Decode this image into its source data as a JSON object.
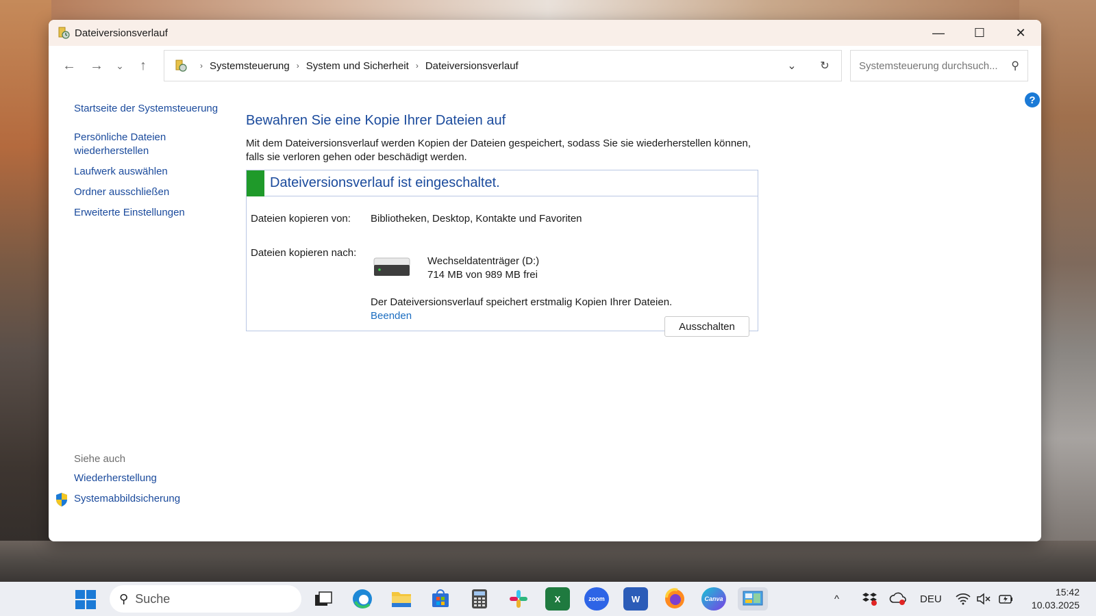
{
  "window": {
    "title": "Dateiversionsverlauf",
    "controls": {
      "minimize": "—",
      "maximize": "☐",
      "close": "✕"
    }
  },
  "nav": {
    "back": "←",
    "forward": "→",
    "recent": "⌄",
    "up": "↑",
    "breadcrumbs": [
      "Systemsteuerung",
      "System und Sicherheit",
      "Dateiversionsverlauf"
    ],
    "separator": "›",
    "dropdown": "⌄",
    "refresh": "↻"
  },
  "search": {
    "placeholder": "Systemsteuerung durchsuch...",
    "icon": "search-icon"
  },
  "sidebar": {
    "items": [
      {
        "label": "Startseite der Systemsteuerung"
      },
      {
        "label": "Persönliche Dateien wiederherstellen"
      },
      {
        "label": "Laufwerk auswählen"
      },
      {
        "label": "Ordner ausschließen"
      },
      {
        "label": "Erweiterte Einstellungen"
      }
    ],
    "see_also": {
      "title": "Siehe auch",
      "items": [
        {
          "label": "Wiederherstellung"
        },
        {
          "label": "Systemabbildsicherung"
        }
      ]
    }
  },
  "help": {
    "label": "?"
  },
  "main": {
    "title": "Bewahren Sie eine Kopie Ihrer Dateien auf",
    "description": "Mit dem Dateiversionsverlauf werden Kopien der Dateien gespeichert, sodass Sie sie wiederherstellen können, falls sie verloren gehen oder beschädigt werden.",
    "status": {
      "title": "Dateiversionsverlauf ist eingeschaltet.",
      "color": "#1f9a2a",
      "copy_from_label": "Dateien kopieren von:",
      "copy_from_value": "Bibliotheken, Desktop, Kontakte und Favoriten",
      "copy_to_label": "Dateien kopieren nach:",
      "drive_name": "Wechseldatenträger (D:)",
      "drive_free": "714 MB von 989 MB frei",
      "note": "Der Dateiversionsverlauf speichert erstmalig Kopien Ihrer Dateien.",
      "stop_link": "Beenden"
    },
    "off_button": "Ausschalten"
  },
  "taskbar": {
    "search_label": "Suche",
    "apps": [
      {
        "name": "task-view",
        "label": ""
      },
      {
        "name": "edge",
        "label": "e"
      },
      {
        "name": "file-explorer",
        "label": ""
      },
      {
        "name": "store",
        "label": ""
      },
      {
        "name": "calculator",
        "label": ""
      },
      {
        "name": "slack",
        "label": "✱"
      },
      {
        "name": "excel",
        "label": "X"
      },
      {
        "name": "zoom",
        "label": "zoom"
      },
      {
        "name": "word",
        "label": "W"
      },
      {
        "name": "firefox",
        "label": ""
      },
      {
        "name": "canva",
        "label": "Canva"
      },
      {
        "name": "control-panel",
        "label": ""
      }
    ],
    "tray": {
      "chevron": "^",
      "language": "DEU"
    },
    "time": "15:42",
    "date": "10.03.2025"
  },
  "colors": {
    "link": "#1a4a9c",
    "accent": "#1b7ad6",
    "status_green": "#1f9a2a"
  }
}
